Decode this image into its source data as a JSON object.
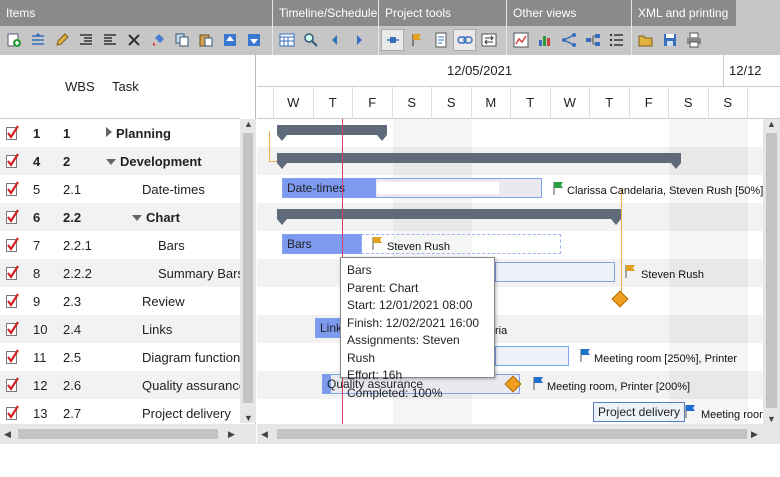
{
  "ribbon": {
    "groups": [
      {
        "title": "Items",
        "icons": [
          "add-item-icon",
          "insert-item-icon",
          "edit-icon",
          "indent-icon",
          "outdent-icon",
          "delete-icon",
          "paint-icon",
          "copy-icon",
          "paste-icon",
          "move-up-icon",
          "move-down-icon"
        ]
      },
      {
        "title": "Timeline/Schedule",
        "icons": [
          "calendar-icon",
          "zoom-icon",
          "scroll-left-icon",
          "scroll-right-icon"
        ]
      },
      {
        "title": "Project tools",
        "icons": [
          "critical-path-icon",
          "flag-icon",
          "document-icon",
          "link-icon",
          "swap-icon"
        ]
      },
      {
        "title": "Other views",
        "icons": [
          "chart-view-icon",
          "bar-chart-icon",
          "network-icon",
          "hierarchy-icon",
          "list-icon"
        ]
      },
      {
        "title": "XML and printing",
        "icons": [
          "open-icon",
          "save-icon",
          "print-icon"
        ]
      }
    ]
  },
  "grid": {
    "headers": {
      "wbs": "WBS",
      "task": "Task"
    },
    "rows": [
      {
        "num": "1",
        "wbs": "1",
        "task": "Planning",
        "level": 0,
        "bold": true,
        "expander": "right"
      },
      {
        "num": "4",
        "wbs": "2",
        "task": "Development",
        "level": 0,
        "bold": true,
        "expander": "down"
      },
      {
        "num": "5",
        "wbs": "2.1",
        "task": "Date-times",
        "level": 1,
        "bold": false,
        "expander": ""
      },
      {
        "num": "6",
        "wbs": "2.2",
        "task": "Chart",
        "level": 1,
        "bold": true,
        "expander": "down"
      },
      {
        "num": "7",
        "wbs": "2.2.1",
        "task": "Bars",
        "level": 2,
        "bold": false,
        "expander": ""
      },
      {
        "num": "8",
        "wbs": "2.2.2",
        "task": "Summary Bars",
        "level": 2,
        "bold": false,
        "expander": ""
      },
      {
        "num": "9",
        "wbs": "2.3",
        "task": "Review",
        "level": 1,
        "bold": false,
        "expander": ""
      },
      {
        "num": "10",
        "wbs": "2.4",
        "task": "Links",
        "level": 1,
        "bold": false,
        "expander": ""
      },
      {
        "num": "11",
        "wbs": "2.5",
        "task": "Diagram functions",
        "level": 1,
        "bold": false,
        "expander": ""
      },
      {
        "num": "12",
        "wbs": "2.6",
        "task": "Quality assurance",
        "level": 1,
        "bold": false,
        "expander": ""
      },
      {
        "num": "13",
        "wbs": "2.7",
        "task": "Project delivery",
        "level": 1,
        "bold": false,
        "expander": ""
      }
    ]
  },
  "timeline": {
    "dates": [
      "12/05/2021",
      "12/12"
    ],
    "days": [
      "W",
      "T",
      "F",
      "S",
      "S",
      "M",
      "T",
      "W",
      "T",
      "F",
      "S",
      "S"
    ]
  },
  "bars": {
    "datetimes": "Date-times",
    "bars": "Bars",
    "links": "Links",
    "qa": "Quality assurance",
    "delivery": "Project delivery"
  },
  "assignments": {
    "datetimes": "Clarissa Candelaria, Steven Rush [50%]",
    "bars": "Steven Rush",
    "summarybars": "Steven Rush",
    "links": "ria",
    "diagram": "Meeting room [250%], Printer",
    "qa": "Meeting room, Printer [200%]",
    "delivery": "Meeting room"
  },
  "tooltip": {
    "title": "Bars",
    "parent": "Parent: Chart",
    "start": "Start: 12/01/2021 08:00",
    "finish": "Finish: 12/02/2021 16:00",
    "assignments": "Assignments: Steven Rush",
    "effort": "Effort: 16h",
    "completed": "Completed: 100%"
  },
  "colors": {
    "ribbon_header": "#8a8a8a",
    "summary": "#5f6b7b",
    "task_fill": "#7b9af0",
    "milestone": "#f0a020",
    "today": "#d04060"
  }
}
